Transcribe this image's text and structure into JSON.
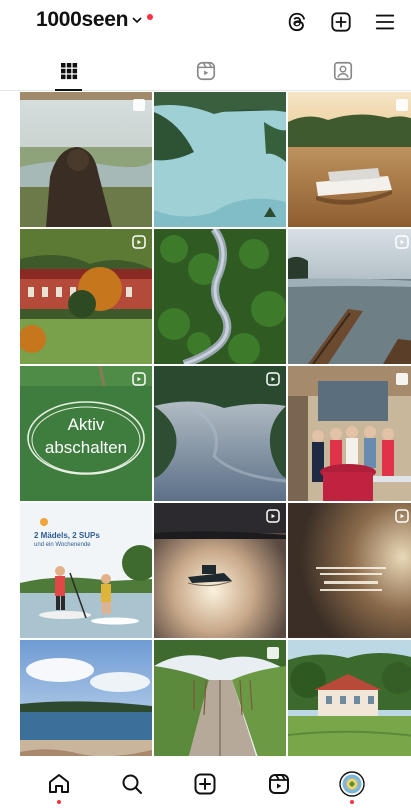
{
  "header": {
    "account_name": "1000seen",
    "icons": [
      "threads-icon",
      "create-icon",
      "menu-icon"
    ]
  },
  "tabs": [
    {
      "name": "posts-grid",
      "icon": "grid-icon",
      "active": true
    },
    {
      "name": "reels",
      "icon": "reels-icon",
      "active": false
    },
    {
      "name": "tagged",
      "icon": "tagged-icon",
      "active": false
    }
  ],
  "posts": {
    "aktiv_title": "Aktiv",
    "aktiv_subtitle": "abschalten",
    "sup_headline_1": "2 Mädels, 2 SUPs",
    "sup_headline_2": "und ein Wochenende"
  },
  "bottom_nav": [
    "home-icon",
    "search-icon",
    "create-icon",
    "reels-icon",
    "profile-avatar"
  ],
  "colors": {
    "accent_dot": "#ff3040",
    "text": "#111111",
    "divider": "#e6e6e6"
  }
}
